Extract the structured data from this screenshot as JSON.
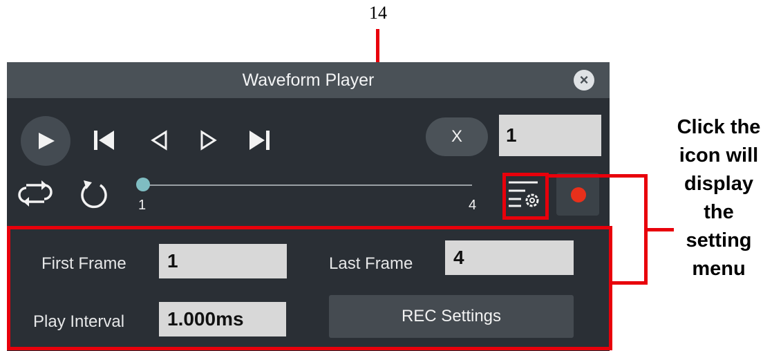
{
  "annotation": {
    "callout_number": "14",
    "note": "Click the icon will display the setting menu"
  },
  "window": {
    "title": "Waveform Player",
    "close_icon": "close-icon"
  },
  "playback": {
    "play_icon": "play-icon",
    "first_frame_icon": "skip-to-start-icon",
    "prev_frame_icon": "step-back-icon",
    "next_frame_icon": "step-forward-icon",
    "last_frame_icon": "skip-to-end-icon",
    "loop_icon": "loop-icon",
    "replay_icon": "replay-icon"
  },
  "speed": {
    "multiplier_label": "X",
    "multiplier_value": "1"
  },
  "slider": {
    "min_label": "1",
    "max_label": "4",
    "current_frame": 1,
    "thumb_color": "#7fbdc2"
  },
  "toolbar": {
    "settings_icon": "settings-menu-icon",
    "record_icon": "record-icon",
    "record_color": "#e8301b"
  },
  "settings": {
    "first_frame_label": "First Frame",
    "first_frame_value": "1",
    "last_frame_label": "Last Frame",
    "last_frame_value": "4",
    "play_interval_label": "Play Interval",
    "play_interval_value": "1.000ms",
    "rec_settings_label": "REC Settings"
  },
  "colors": {
    "annotation_red": "#e8000b",
    "window_bg": "#2a2f35",
    "titlebar_bg": "#4a5157"
  }
}
